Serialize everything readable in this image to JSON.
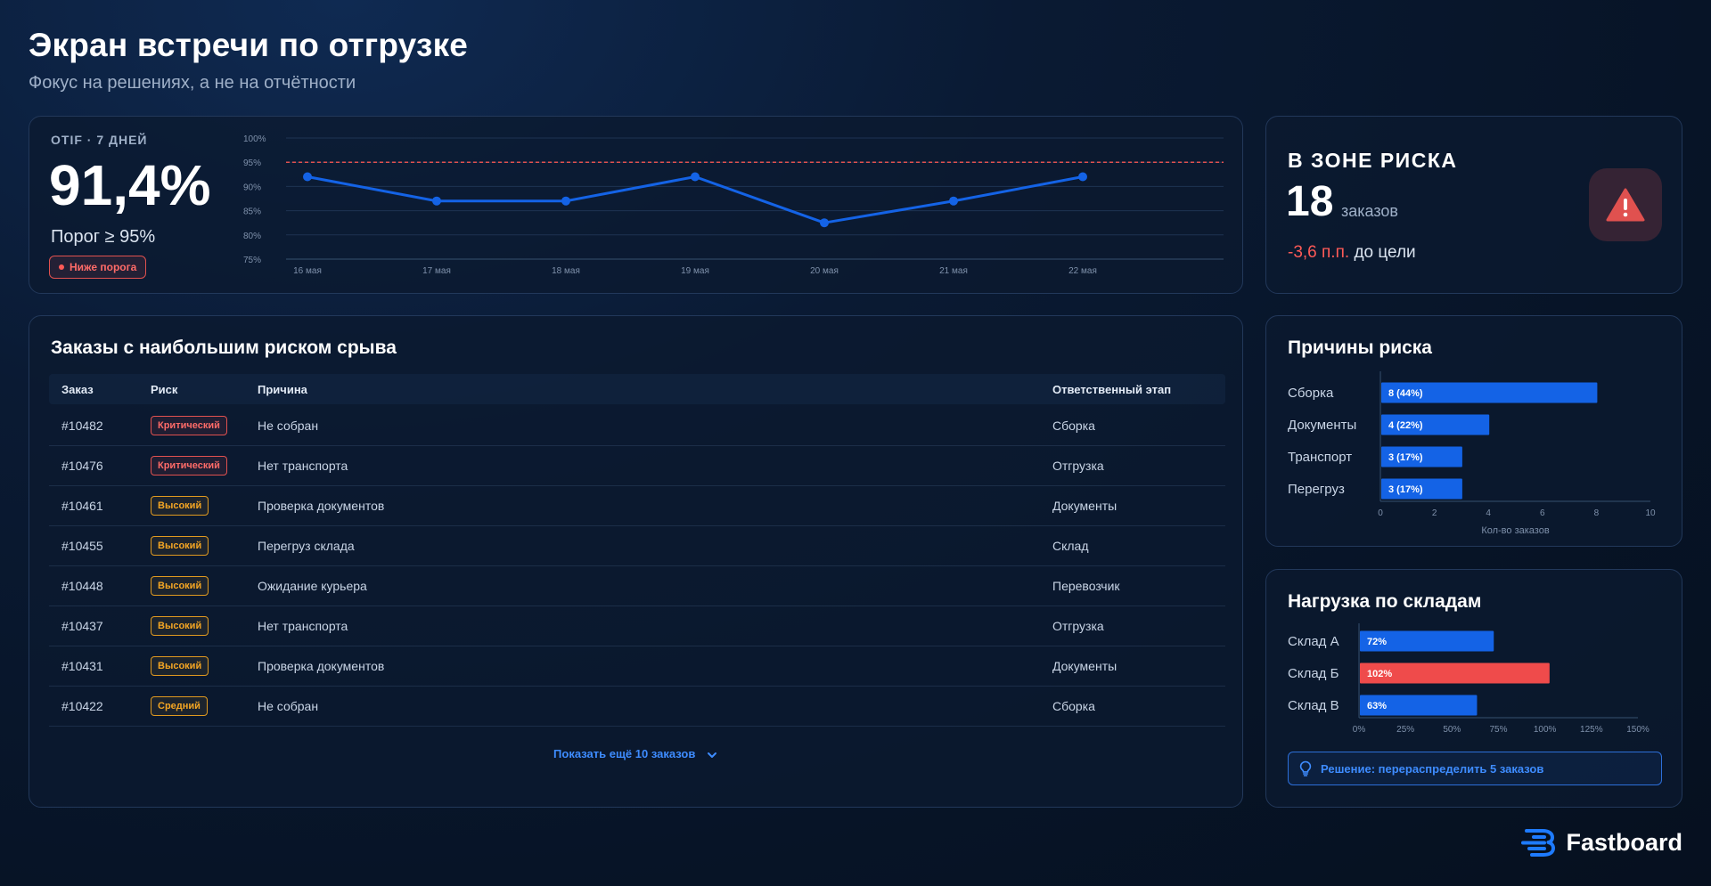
{
  "header": {
    "title": "Экран встречи по отгрузке",
    "subtitle": "Фокус на решениях, а не на отчётности"
  },
  "otif": {
    "label": "OTIF · 7 ДНЕЙ",
    "value": "91,4%",
    "threshold": "Порог ≥ 95%",
    "status": "Ниже порога"
  },
  "risk_zone": {
    "title": "В ЗОНЕ РИСКА",
    "count": "18",
    "unit": "заказов",
    "delta_value": "-3,6 п.п.",
    "delta_text": "до цели",
    "alert_icon": "warning-triangle-icon"
  },
  "orders": {
    "title": "Заказы с наибольшим риском срыва",
    "columns": {
      "order": "Заказ",
      "risk": "Риск",
      "reason": "Причина",
      "stage": "Ответственный этап"
    },
    "rows": [
      {
        "order": "#10482",
        "risk": "Критический",
        "level": "crit",
        "reason": "Не собран",
        "stage": "Сборка"
      },
      {
        "order": "#10476",
        "risk": "Критический",
        "level": "crit",
        "reason": "Нет транспорта",
        "stage": "Отгрузка"
      },
      {
        "order": "#10461",
        "risk": "Высокий",
        "level": "high",
        "reason": "Проверка документов",
        "stage": "Документы"
      },
      {
        "order": "#10455",
        "risk": "Высокий",
        "level": "high",
        "reason": "Перегруз склада",
        "stage": "Склад"
      },
      {
        "order": "#10448",
        "risk": "Высокий",
        "level": "high",
        "reason": "Ожидание курьера",
        "stage": "Перевозчик"
      },
      {
        "order": "#10437",
        "risk": "Высокий",
        "level": "high",
        "reason": "Нет транспорта",
        "stage": "Отгрузка"
      },
      {
        "order": "#10431",
        "risk": "Высокий",
        "level": "high",
        "reason": "Проверка документов",
        "stage": "Документы"
      },
      {
        "order": "#10422",
        "risk": "Средний",
        "level": "mid",
        "reason": "Не собран",
        "stage": "Сборка"
      }
    ],
    "show_more": "Показать ещё 10 заказов"
  },
  "reasons": {
    "title": "Причины риска"
  },
  "warehouses": {
    "title": "Нагрузка по складам",
    "decision": "Решение: перераспределить 5 заказов"
  },
  "brand": {
    "name": "Fastboard"
  },
  "colors": {
    "accent_blue": "#1463e6",
    "danger_red": "#ef4b4b",
    "warning_orange": "#f5a623",
    "target_line": "#e0514f"
  },
  "chart_data": [
    {
      "type": "line",
      "x": [
        "16 мая",
        "17 мая",
        "18 мая",
        "19 мая",
        "20 мая",
        "21 мая",
        "22 мая"
      ],
      "series": [
        {
          "values": [
            92,
            87,
            87,
            92,
            82.5,
            87,
            92
          ]
        }
      ],
      "ylim": [
        75,
        100
      ],
      "yticks": [
        "75%",
        "80%",
        "85%",
        "90%",
        "95%",
        "100%"
      ],
      "target": 95,
      "grid": true
    },
    {
      "type": "bar",
      "orientation": "horizontal",
      "categories": [
        "Сборка",
        "Документы",
        "Транспорт",
        "Перегруз"
      ],
      "values": [
        8,
        4,
        3,
        3
      ],
      "labels": [
        "8 (44%)",
        "4 (22%)",
        "3 (17%)",
        "3 (17%)"
      ],
      "xlim": [
        0,
        10
      ],
      "xticks": [
        "0",
        "2",
        "4",
        "6",
        "8",
        "10"
      ],
      "xlabel": "Кол-во заказов"
    },
    {
      "type": "bar",
      "orientation": "horizontal",
      "categories": [
        "Склад А",
        "Склад Б",
        "Склад В"
      ],
      "values": [
        72,
        102,
        63
      ],
      "labels": [
        "72%",
        "102%",
        "63%"
      ],
      "xlim": [
        0,
        150
      ],
      "xticks": [
        "0%",
        "25%",
        "50%",
        "75%",
        "100%",
        "125%",
        "150%"
      ],
      "overload": [
        false,
        true,
        false
      ]
    }
  ]
}
